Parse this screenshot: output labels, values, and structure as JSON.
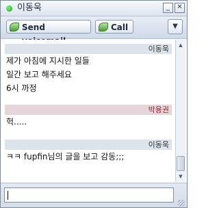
{
  "window": {
    "title": "이동욱"
  },
  "toolbar": {
    "voicemail_label": "Send voicemail",
    "call_label": "Call"
  },
  "messages": [
    {
      "sender": "이동욱",
      "lines": [
        "제가 아침에 지시한 일들",
        "일간 보고 해주세요",
        "6시 까정"
      ]
    },
    {
      "sender": "박용권",
      "lines": [
        "헉....."
      ]
    },
    {
      "sender": "이동욱",
      "lines": [
        "ㅋㅋ fupfin님의 글을 보고 감동;;;"
      ]
    }
  ],
  "input": {
    "value": ""
  }
}
